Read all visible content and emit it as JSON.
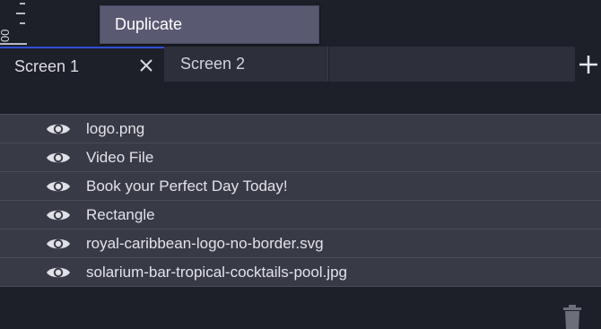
{
  "ruler": {
    "label": "00"
  },
  "context_menu": {
    "items": [
      {
        "label": "Duplicate"
      }
    ]
  },
  "tabs": [
    {
      "label": "Screen 1",
      "active": true,
      "closable": true
    },
    {
      "label": "Screen 2",
      "active": false,
      "closable": false
    }
  ],
  "tab_bar": {
    "add_icon": "plus-icon",
    "close_icon": "close-icon"
  },
  "layers": [
    {
      "label": "logo.png",
      "visible": true
    },
    {
      "label": "Video File",
      "visible": true
    },
    {
      "label": "Book your Perfect Day Today!",
      "visible": true
    },
    {
      "label": "Rectangle",
      "visible": true
    },
    {
      "label": "royal-caribbean-logo-no-border.svg",
      "visible": true
    },
    {
      "label": "solarium-bar-tropical-cocktails-pool.jpg",
      "visible": true
    }
  ],
  "footer": {
    "delete_icon": "trash-icon"
  },
  "colors": {
    "background": "#1d1f29",
    "row": "#383a46",
    "tab_inactive": "#2d2f3b",
    "active_tab_accent": "#2f4fd3",
    "menu": "#5a5972"
  }
}
